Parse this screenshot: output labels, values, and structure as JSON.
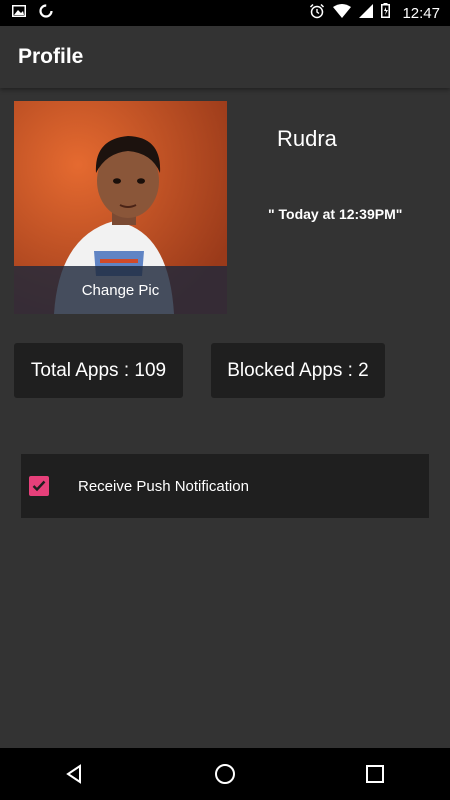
{
  "status_bar": {
    "time": "12:47",
    "icons": [
      "image-icon",
      "sync-icon",
      "alarm-icon",
      "wifi-icon",
      "signal-icon",
      "battery-icon"
    ]
  },
  "app_bar": {
    "title": "Profile"
  },
  "profile": {
    "name": "Rudra",
    "last_seen": "\"  Today at 12:39PM\"",
    "change_pic_label": "Change Pic"
  },
  "stats": {
    "total_apps": "Total Apps : 109",
    "blocked_apps": "Blocked Apps : 2"
  },
  "settings": {
    "push_notification_label": "Receive Push Notification",
    "push_notification_checked": true
  },
  "nav_bar": {
    "buttons": [
      "back-icon",
      "home-icon",
      "recents-icon"
    ]
  },
  "colors": {
    "accent": "#e6407a",
    "background": "#333333",
    "card": "#1f1f1f"
  }
}
